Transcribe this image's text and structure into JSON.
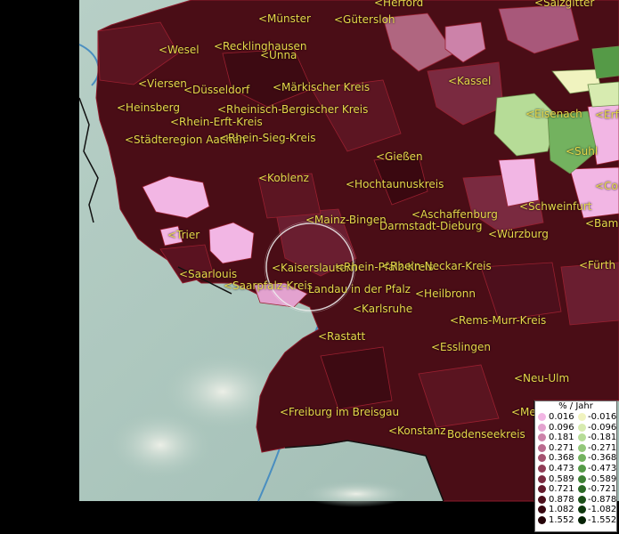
{
  "map": {
    "cities": [
      {
        "label": "<Herford",
        "pos": [
          420,
          -4
        ]
      },
      {
        "label": "<Salzgitter",
        "pos": [
          600,
          -4
        ]
      },
      {
        "label": "<Münster",
        "pos": [
          290,
          14
        ]
      },
      {
        "label": "<Gütersloh",
        "pos": [
          375,
          15
        ]
      },
      {
        "label": "<Wesel",
        "pos": [
          178,
          49
        ]
      },
      {
        "label": "<Recklinghausen",
        "pos": [
          240,
          45
        ]
      },
      {
        "label": "<Unna",
        "pos": [
          292,
          55
        ]
      },
      {
        "label": "<Viersen",
        "pos": [
          155,
          87
        ]
      },
      {
        "label": "<Düsseldorf",
        "pos": [
          206,
          94
        ]
      },
      {
        "label": "<Märkischer Kreis",
        "pos": [
          306,
          91
        ]
      },
      {
        "label": "<Kassel",
        "pos": [
          503,
          84
        ]
      },
      {
        "label": "<Heinsberg",
        "pos": [
          131,
          114
        ]
      },
      {
        "label": "<Rheinisch-Bergischer Kreis",
        "pos": [
          244,
          116
        ]
      },
      {
        "label": "<Rhein-Erft-Kreis",
        "pos": [
          191,
          130
        ]
      },
      {
        "label": "<Eisenach",
        "pos": [
          590,
          121
        ]
      },
      {
        "label": "<Erfu",
        "pos": [
          668,
          122
        ]
      },
      {
        "label": "<Städteregion Aachen",
        "pos": [
          140,
          150
        ]
      },
      {
        "label": "<Rhein-Sieg-Kreis",
        "pos": [
          246,
          148
        ]
      },
      {
        "label": "<Suhl",
        "pos": [
          635,
          163
        ]
      },
      {
        "label": "<Gießen",
        "pos": [
          422,
          169
        ]
      },
      {
        "label": "<Koblenz",
        "pos": [
          290,
          193
        ]
      },
      {
        "label": "<Hochtaunuskreis",
        "pos": [
          388,
          200
        ]
      },
      {
        "label": "<Co",
        "pos": [
          668,
          202
        ]
      },
      {
        "label": "<Schweinfurt",
        "pos": [
          583,
          225
        ]
      },
      {
        "label": "<Mainz-Bingen",
        "pos": [
          343,
          240
        ]
      },
      {
        "label": "<Aschaffenburg",
        "pos": [
          462,
          234
        ]
      },
      {
        "label": "Darmstadt-Dieburg",
        "pos": [
          426,
          247
        ]
      },
      {
        "label": "<Bamb",
        "pos": [
          657,
          244
        ]
      },
      {
        "label": "<Trier",
        "pos": [
          188,
          257
        ]
      },
      {
        "label": "<Würzburg",
        "pos": [
          548,
          256
        ]
      },
      {
        "label": "<Kaiserslautern",
        "pos": [
          305,
          294
        ]
      },
      {
        "label": "<Rhein-Pfalz-Kreis",
        "pos": [
          376,
          293
        ]
      },
      {
        "label": "<Rhein-Neckar-Kreis",
        "pos": [
          428,
          292
        ]
      },
      {
        "label": "<Fürth",
        "pos": [
          650,
          291
        ]
      },
      {
        "label": "<Saarlouis",
        "pos": [
          201,
          301
        ]
      },
      {
        "label": "<Saarpfalz-Kreis",
        "pos": [
          251,
          314
        ]
      },
      {
        "label": "Landau in der Pfalz",
        "pos": [
          346,
          318
        ]
      },
      {
        "label": "<Heilbronn",
        "pos": [
          466,
          323
        ]
      },
      {
        "label": "<Karlsruhe",
        "pos": [
          396,
          340
        ]
      },
      {
        "label": "<Rems-Murr-Kreis",
        "pos": [
          505,
          353
        ]
      },
      {
        "label": "<Rastatt",
        "pos": [
          357,
          371
        ]
      },
      {
        "label": "<Esslingen",
        "pos": [
          484,
          383
        ]
      },
      {
        "label": "<Neu-Ulm",
        "pos": [
          577,
          418
        ]
      },
      {
        "label": "<Freiburg im Breisgau",
        "pos": [
          314,
          456
        ]
      },
      {
        "label": "<Me",
        "pos": [
          574,
          456
        ]
      },
      {
        "label": "<Konstanz",
        "pos": [
          436,
          477
        ]
      },
      {
        "label": "Bodenseekreis",
        "pos": [
          502,
          481
        ]
      }
    ]
  },
  "legend": {
    "title": "% / Jahr",
    "positive": [
      {
        "value": "0.016",
        "color": "#f2b6e4"
      },
      {
        "value": "0.096",
        "color": "#e3a2cf"
      },
      {
        "value": "0.181",
        "color": "#cc82a9"
      },
      {
        "value": "0.271",
        "color": "#b96a8e"
      },
      {
        "value": "0.368",
        "color": "#a45270"
      },
      {
        "value": "0.473",
        "color": "#8f3c56"
      },
      {
        "value": "0.589",
        "color": "#7a2a40"
      },
      {
        "value": "0.721",
        "color": "#641a2c"
      },
      {
        "value": "0.878",
        "color": "#4d0f1c"
      },
      {
        "value": "1.082",
        "color": "#380710"
      },
      {
        "value": "1.552",
        "color": "#250308"
      }
    ],
    "negative": [
      {
        "value": "-0.016",
        "color": "#f0f3bf"
      },
      {
        "value": "-0.096",
        "color": "#d7ebb0"
      },
      {
        "value": "-0.181",
        "color": "#b6dc97"
      },
      {
        "value": "-0.271",
        "color": "#93c77a"
      },
      {
        "value": "-0.368",
        "color": "#73b25f"
      },
      {
        "value": "-0.473",
        "color": "#559a47"
      },
      {
        "value": "-0.589",
        "color": "#3e8135"
      },
      {
        "value": "-0.721",
        "color": "#2b6926"
      },
      {
        "value": "-0.878",
        "color": "#1c5019"
      },
      {
        "value": "-1.082",
        "color": "#0f380e"
      },
      {
        "value": "-1.552",
        "color": "#062205"
      }
    ]
  }
}
